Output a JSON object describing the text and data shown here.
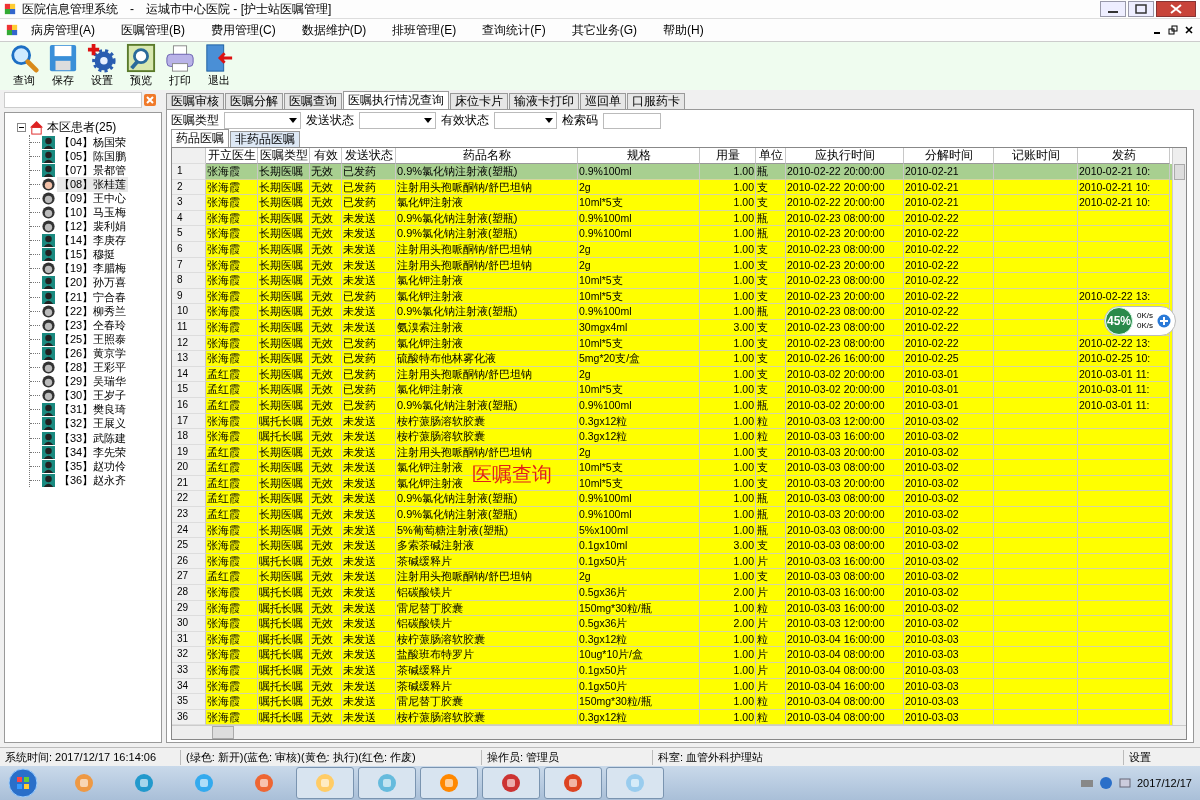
{
  "window": {
    "title": "医院信息管理系统　-　运城市中心医院 - [护士站医嘱管理]"
  },
  "menu": [
    "病房管理(A)",
    "医嘱管理(B)",
    "费用管理(C)",
    "数据维护(D)",
    "排班管理(E)",
    "查询统计(F)",
    "其它业务(G)",
    "帮助(H)"
  ],
  "toolbar": [
    "查询",
    "保存",
    "设置",
    "预览",
    "打印",
    "退出"
  ],
  "sidebar": {
    "root": {
      "label": "本区患者(25)",
      "expanded": true,
      "children": [
        {
          "label": "【04】杨国荣",
          "kind": "male",
          "selected": false
        },
        {
          "label": "【05】陈国鹏",
          "kind": "male",
          "selected": false
        },
        {
          "label": "【07】景都管",
          "kind": "male",
          "selected": false
        },
        {
          "label": "【08】张桂莲",
          "kind": "female",
          "selected": true
        },
        {
          "label": "【09】王中心",
          "kind": "female",
          "selected": false
        },
        {
          "label": "【10】马玉梅",
          "kind": "female",
          "selected": false
        },
        {
          "label": "【12】裴利娟",
          "kind": "female",
          "selected": false
        },
        {
          "label": "【14】李庚存",
          "kind": "male",
          "selected": false
        },
        {
          "label": "【15】穆挺",
          "kind": "male",
          "selected": false
        },
        {
          "label": "【19】李腊梅",
          "kind": "female",
          "selected": false
        },
        {
          "label": "【20】孙万喜",
          "kind": "male",
          "selected": false
        },
        {
          "label": "【21】宁合春",
          "kind": "male",
          "selected": false
        },
        {
          "label": "【22】柳秀兰",
          "kind": "female",
          "selected": false
        },
        {
          "label": "【23】仝春玲",
          "kind": "female",
          "selected": false
        },
        {
          "label": "【25】王照泰",
          "kind": "male",
          "selected": false
        },
        {
          "label": "【26】黄京学",
          "kind": "male",
          "selected": false
        },
        {
          "label": "【28】王彩平",
          "kind": "female",
          "selected": false
        },
        {
          "label": "【29】吴瑞华",
          "kind": "female",
          "selected": false
        },
        {
          "label": "【30】王岁子",
          "kind": "female",
          "selected": false
        },
        {
          "label": "【31】樊良琦",
          "kind": "male",
          "selected": false
        },
        {
          "label": "【32】王展义",
          "kind": "male",
          "selected": false
        },
        {
          "label": "【33】武陈建",
          "kind": "male",
          "selected": false
        },
        {
          "label": "【34】李先荣",
          "kind": "male",
          "selected": false
        },
        {
          "label": "【35】赵功伶",
          "kind": "male",
          "selected": false
        },
        {
          "label": "【36】赵永齐",
          "kind": "male",
          "selected": false
        }
      ]
    }
  },
  "tabs": [
    {
      "label": "医嘱审核",
      "selected": false
    },
    {
      "label": "医嘱分解",
      "selected": false
    },
    {
      "label": "医嘱查询",
      "selected": false
    },
    {
      "label": "医嘱执行情况查询",
      "selected": true
    },
    {
      "label": "床位卡片",
      "selected": false
    },
    {
      "label": "输液卡打印",
      "selected": false
    },
    {
      "label": "巡回单",
      "selected": false
    },
    {
      "label": "口服药卡",
      "selected": false
    }
  ],
  "filters": [
    {
      "label": "医嘱类型",
      "kind": "select"
    },
    {
      "label": "发送状态",
      "kind": "select"
    },
    {
      "label": "有效状态",
      "kind": "select"
    },
    {
      "label": "检索码",
      "kind": "input"
    }
  ],
  "subtabs": [
    {
      "label": "药品医嘱",
      "selected": true
    },
    {
      "label": "非药品医嘱",
      "selected": false
    }
  ],
  "table": {
    "columns": [
      "开立医生",
      "医嘱类型",
      "有效",
      "发送状态",
      "药品名称",
      "规格",
      "用量",
      "单位",
      "应执行时间",
      "分解时间",
      "记账时间",
      "发药"
    ],
    "rows": [
      {
        "num": "1",
        "selected": true,
        "doctor": "张海霞",
        "order_type": "长期医嘱",
        "valid": "无效",
        "send_status": "已发药",
        "drug": "0.9%氯化钠注射液(塑瓶)",
        "spec": "0.9%100ml",
        "dose": "1.00",
        "unit": "瓶",
        "exec_time": "2010-02-22 20:00:00",
        "split_time": "2010-02-21",
        "column_12": "2010-02-21 10:"
      },
      {
        "num": "2",
        "selected": false,
        "doctor": "张海霞",
        "order_type": "长期医嘱",
        "valid": "无效",
        "send_status": "已发药",
        "drug": "注射用头孢哌酮钠/舒巴坦钠",
        "spec": "2g",
        "dose": "1.00",
        "unit": "支",
        "exec_time": "2010-02-22 20:00:00",
        "split_time": "2010-02-21",
        "column_12": "2010-02-21 10:"
      },
      {
        "num": "3",
        "selected": false,
        "doctor": "张海霞",
        "order_type": "长期医嘱",
        "valid": "无效",
        "send_status": "已发药",
        "drug": "氯化钾注射液",
        "spec": "10ml*5支",
        "dose": "1.00",
        "unit": "支",
        "exec_time": "2010-02-22 20:00:00",
        "split_time": "2010-02-21",
        "column_12": "2010-02-21 10:"
      },
      {
        "num": "4",
        "selected": false,
        "doctor": "张海霞",
        "order_type": "长期医嘱",
        "valid": "无效",
        "send_status": "未发送",
        "drug": "0.9%氯化钠注射液(塑瓶)",
        "spec": "0.9%100ml",
        "dose": "1.00",
        "unit": "瓶",
        "exec_time": "2010-02-23 08:00:00",
        "split_time": "2010-02-22"
      },
      {
        "num": "5",
        "selected": false,
        "doctor": "张海霞",
        "order_type": "长期医嘱",
        "valid": "无效",
        "send_status": "未发送",
        "drug": "0.9%氯化钠注射液(塑瓶)",
        "spec": "0.9%100ml",
        "dose": "1.00",
        "unit": "瓶",
        "exec_time": "2010-02-23 20:00:00",
        "split_time": "2010-02-22"
      },
      {
        "num": "6",
        "selected": false,
        "doctor": "张海霞",
        "order_type": "长期医嘱",
        "valid": "无效",
        "send_status": "未发送",
        "drug": "注射用头孢哌酮钠/舒巴坦钠",
        "spec": "2g",
        "dose": "1.00",
        "unit": "支",
        "exec_time": "2010-02-23 08:00:00",
        "split_time": "2010-02-22"
      },
      {
        "num": "7",
        "selected": false,
        "doctor": "张海霞",
        "order_type": "长期医嘱",
        "valid": "无效",
        "send_status": "未发送",
        "drug": "注射用头孢哌酮钠/舒巴坦钠",
        "spec": "2g",
        "dose": "1.00",
        "unit": "支",
        "exec_time": "2010-02-23 20:00:00",
        "split_time": "2010-02-22"
      },
      {
        "num": "8",
        "selected": false,
        "doctor": "张海霞",
        "order_type": "长期医嘱",
        "valid": "无效",
        "send_status": "未发送",
        "drug": "氯化钾注射液",
        "spec": "10ml*5支",
        "dose": "1.00",
        "unit": "支",
        "exec_time": "2010-02-23 08:00:00",
        "split_time": "2010-02-22"
      },
      {
        "num": "9",
        "selected": false,
        "doctor": "张海霞",
        "order_type": "长期医嘱",
        "valid": "无效",
        "send_status": "已发药",
        "drug": "氯化钾注射液",
        "spec": "10ml*5支",
        "dose": "1.00",
        "unit": "支",
        "exec_time": "2010-02-23 20:00:00",
        "split_time": "2010-02-22",
        "column_12": "2010-02-22 13:"
      },
      {
        "num": "10",
        "selected": false,
        "doctor": "张海霞",
        "order_type": "长期医嘱",
        "valid": "无效",
        "send_status": "未发送",
        "drug": "0.9%氯化钠注射液(塑瓶)",
        "spec": "0.9%100ml",
        "dose": "1.00",
        "unit": "瓶",
        "exec_time": "2010-02-23 08:00:00",
        "split_time": "2010-02-22"
      },
      {
        "num": "11",
        "selected": false,
        "doctor": "张海霞",
        "order_type": "长期医嘱",
        "valid": "无效",
        "send_status": "未发送",
        "drug": "氨溴索注射液",
        "spec": "30mgx4ml",
        "dose": "3.00",
        "unit": "支",
        "exec_time": "2010-02-23 08:00:00",
        "split_time": "2010-02-22"
      },
      {
        "num": "12",
        "selected": false,
        "doctor": "张海霞",
        "order_type": "长期医嘱",
        "valid": "无效",
        "send_status": "已发药",
        "drug": "氯化钾注射液",
        "spec": "10ml*5支",
        "dose": "1.00",
        "unit": "支",
        "exec_time": "2010-02-23 08:00:00",
        "split_time": "2010-02-22",
        "column_12": "2010-02-22 13:"
      },
      {
        "num": "13",
        "selected": false,
        "doctor": "张海霞",
        "order_type": "长期医嘱",
        "valid": "无效",
        "send_status": "已发药",
        "drug": "硫酸特布他林雾化液",
        "spec": "5mg*20支/盒",
        "dose": "1.00",
        "unit": "支",
        "exec_time": "2010-02-26 16:00:00",
        "split_time": "2010-02-25",
        "column_12": "2010-02-25 10:"
      },
      {
        "num": "14",
        "selected": false,
        "doctor": "孟红霞",
        "order_type": "长期医嘱",
        "valid": "无效",
        "send_status": "已发药",
        "drug": "注射用头孢哌酮钠/舒巴坦钠",
        "spec": "2g",
        "dose": "1.00",
        "unit": "支",
        "exec_time": "2010-03-02 20:00:00",
        "split_time": "2010-03-01",
        "column_12": "2010-03-01 11:"
      },
      {
        "num": "15",
        "selected": false,
        "doctor": "孟红霞",
        "order_type": "长期医嘱",
        "valid": "无效",
        "send_status": "已发药",
        "drug": "氯化钾注射液",
        "spec": "10ml*5支",
        "dose": "1.00",
        "unit": "支",
        "exec_time": "2010-03-02 20:00:00",
        "split_time": "2010-03-01",
        "column_12": "2010-03-01 11:"
      },
      {
        "num": "16",
        "selected": false,
        "doctor": "孟红霞",
        "order_type": "长期医嘱",
        "valid": "无效",
        "send_status": "已发药",
        "drug": "0.9%氯化钠注射液(塑瓶)",
        "spec": "0.9%100ml",
        "dose": "1.00",
        "unit": "瓶",
        "exec_time": "2010-03-02 20:00:00",
        "split_time": "2010-03-01",
        "column_12": "2010-03-01 11:"
      },
      {
        "num": "17",
        "selected": false,
        "doctor": "张海霞",
        "order_type": "嘱托长嘱",
        "valid": "无效",
        "send_status": "未发送",
        "drug": "桉柠蒎肠溶软胶囊",
        "spec": "0.3gx12粒",
        "dose": "1.00",
        "unit": "粒",
        "exec_time": "2010-03-03 12:00:00",
        "split_time": "2010-03-02"
      },
      {
        "num": "18",
        "selected": false,
        "doctor": "张海霞",
        "order_type": "嘱托长嘱",
        "valid": "无效",
        "send_status": "未发送",
        "drug": "桉柠蒎肠溶软胶囊",
        "spec": "0.3gx12粒",
        "dose": "1.00",
        "unit": "粒",
        "exec_time": "2010-03-03 16:00:00",
        "split_time": "2010-03-02"
      },
      {
        "num": "19",
        "selected": false,
        "doctor": "孟红霞",
        "order_type": "长期医嘱",
        "valid": "无效",
        "send_status": "未发送",
        "drug": "注射用头孢哌酮钠/舒巴坦钠",
        "spec": "2g",
        "dose": "1.00",
        "unit": "支",
        "exec_time": "2010-03-03 20:00:00",
        "split_time": "2010-03-02"
      },
      {
        "num": "20",
        "selected": false,
        "doctor": "孟红霞",
        "order_type": "长期医嘱",
        "valid": "无效",
        "send_status": "未发送",
        "drug": "氯化钾注射液",
        "spec": "10ml*5支",
        "dose": "1.00",
        "unit": "支",
        "exec_time": "2010-03-03 08:00:00",
        "split_time": "2010-03-02"
      },
      {
        "num": "21",
        "selected": false,
        "doctor": "孟红霞",
        "order_type": "长期医嘱",
        "valid": "无效",
        "send_status": "未发送",
        "drug": "氯化钾注射液",
        "spec": "10ml*5支",
        "dose": "1.00",
        "unit": "支",
        "exec_time": "2010-03-03 20:00:00",
        "split_time": "2010-03-02"
      },
      {
        "num": "22",
        "selected": false,
        "doctor": "孟红霞",
        "order_type": "长期医嘱",
        "valid": "无效",
        "send_status": "未发送",
        "drug": "0.9%氯化钠注射液(塑瓶)",
        "spec": "0.9%100ml",
        "dose": "1.00",
        "unit": "瓶",
        "exec_time": "2010-03-03 08:00:00",
        "split_time": "2010-03-02"
      },
      {
        "num": "23",
        "selected": false,
        "doctor": "孟红霞",
        "order_type": "长期医嘱",
        "valid": "无效",
        "send_status": "未发送",
        "drug": "0.9%氯化钠注射液(塑瓶)",
        "spec": "0.9%100ml",
        "dose": "1.00",
        "unit": "瓶",
        "exec_time": "2010-03-03 20:00:00",
        "split_time": "2010-03-02"
      },
      {
        "num": "24",
        "selected": false,
        "doctor": "张海霞",
        "order_type": "长期医嘱",
        "valid": "无效",
        "send_status": "未发送",
        "drug": "5%葡萄糖注射液(塑瓶)",
        "spec": "5%x100ml",
        "dose": "1.00",
        "unit": "瓶",
        "exec_time": "2010-03-03 08:00:00",
        "split_time": "2010-03-02"
      },
      {
        "num": "25",
        "selected": false,
        "doctor": "张海霞",
        "order_type": "长期医嘱",
        "valid": "无效",
        "send_status": "未发送",
        "drug": "多索茶碱注射液",
        "spec": "0.1gx10ml",
        "dose": "3.00",
        "unit": "支",
        "exec_time": "2010-03-03 08:00:00",
        "split_time": "2010-03-02"
      },
      {
        "num": "26",
        "selected": false,
        "doctor": "张海霞",
        "order_type": "嘱托长嘱",
        "valid": "无效",
        "send_status": "未发送",
        "drug": "茶碱缓释片",
        "spec": "0.1gx50片",
        "dose": "1.00",
        "unit": "片",
        "exec_time": "2010-03-03 16:00:00",
        "split_time": "2010-03-02"
      },
      {
        "num": "27",
        "selected": false,
        "doctor": "孟红霞",
        "order_type": "长期医嘱",
        "valid": "无效",
        "send_status": "未发送",
        "drug": "注射用头孢哌酮钠/舒巴坦钠",
        "spec": "2g",
        "dose": "1.00",
        "unit": "支",
        "exec_time": "2010-03-03 08:00:00",
        "split_time": "2010-03-02"
      },
      {
        "num": "28",
        "selected": false,
        "doctor": "张海霞",
        "order_type": "嘱托长嘱",
        "valid": "无效",
        "send_status": "未发送",
        "drug": "铝碳酸镁片",
        "spec": "0.5gx36片",
        "dose": "2.00",
        "unit": "片",
        "exec_time": "2010-03-03 16:00:00",
        "split_time": "2010-03-02"
      },
      {
        "num": "29",
        "selected": false,
        "doctor": "张海霞",
        "order_type": "嘱托长嘱",
        "valid": "无效",
        "send_status": "未发送",
        "drug": "雷尼替丁胶囊",
        "spec": "150mg*30粒/瓶",
        "dose": "1.00",
        "unit": "粒",
        "exec_time": "2010-03-03 16:00:00",
        "split_time": "2010-03-02"
      },
      {
        "num": "30",
        "selected": false,
        "doctor": "张海霞",
        "order_type": "嘱托长嘱",
        "valid": "无效",
        "send_status": "未发送",
        "drug": "铝碳酸镁片",
        "spec": "0.5gx36片",
        "dose": "2.00",
        "unit": "片",
        "exec_time": "2010-03-03 12:00:00",
        "split_time": "2010-03-02"
      },
      {
        "num": "31",
        "selected": false,
        "doctor": "张海霞",
        "order_type": "嘱托长嘱",
        "valid": "无效",
        "send_status": "未发送",
        "drug": "桉柠蒎肠溶软胶囊",
        "spec": "0.3gx12粒",
        "dose": "1.00",
        "unit": "粒",
        "exec_time": "2010-03-04 16:00:00",
        "split_time": "2010-03-03"
      },
      {
        "num": "32",
        "selected": false,
        "doctor": "张海霞",
        "order_type": "嘱托长嘱",
        "valid": "无效",
        "send_status": "未发送",
        "drug": "盐酸班布特罗片",
        "spec": "10ug*10片/盒",
        "dose": "1.00",
        "unit": "片",
        "exec_time": "2010-03-04 08:00:00",
        "split_time": "2010-03-03"
      },
      {
        "num": "33",
        "selected": false,
        "doctor": "张海霞",
        "order_type": "嘱托长嘱",
        "valid": "无效",
        "send_status": "未发送",
        "drug": "茶碱缓释片",
        "spec": "0.1gx50片",
        "dose": "1.00",
        "unit": "片",
        "exec_time": "2010-03-04 08:00:00",
        "split_time": "2010-03-03"
      },
      {
        "num": "34",
        "selected": false,
        "doctor": "张海霞",
        "order_type": "嘱托长嘱",
        "valid": "无效",
        "send_status": "未发送",
        "drug": "茶碱缓释片",
        "spec": "0.1gx50片",
        "dose": "1.00",
        "unit": "片",
        "exec_time": "2010-03-04 16:00:00",
        "split_time": "2010-03-03"
      },
      {
        "num": "35",
        "selected": false,
        "doctor": "张海霞",
        "order_type": "嘱托长嘱",
        "valid": "无效",
        "send_status": "未发送",
        "drug": "雷尼替丁胶囊",
        "spec": "150mg*30粒/瓶",
        "dose": "1.00",
        "unit": "粒",
        "exec_time": "2010-03-04 08:00:00",
        "split_time": "2010-03-03"
      },
      {
        "num": "36",
        "selected": false,
        "doctor": "张海霞",
        "order_type": "嘱托长嘱",
        "valid": "无效",
        "send_status": "未发送",
        "drug": "桉柠蒎肠溶软胶囊",
        "spec": "0.3gx12粒",
        "dose": "1.00",
        "unit": "粒",
        "exec_time": "2010-03-04 08:00:00",
        "split_time": "2010-03-03"
      }
    ]
  },
  "annotation": "医嘱查询",
  "net_widget": {
    "percent": "45%",
    "upload": "0K/s",
    "download": "0K/s"
  },
  "status_bar": [
    "系统时间: 2017/12/17 16:14:06",
    "(绿色: 新开)(蓝色: 审核)(黄色: 执行)(红色: 作废)",
    "操作员: 管理员",
    "科室: 血管外科护理站",
    "设置"
  ],
  "taskbar": {
    "clock": "2017/12/17"
  }
}
